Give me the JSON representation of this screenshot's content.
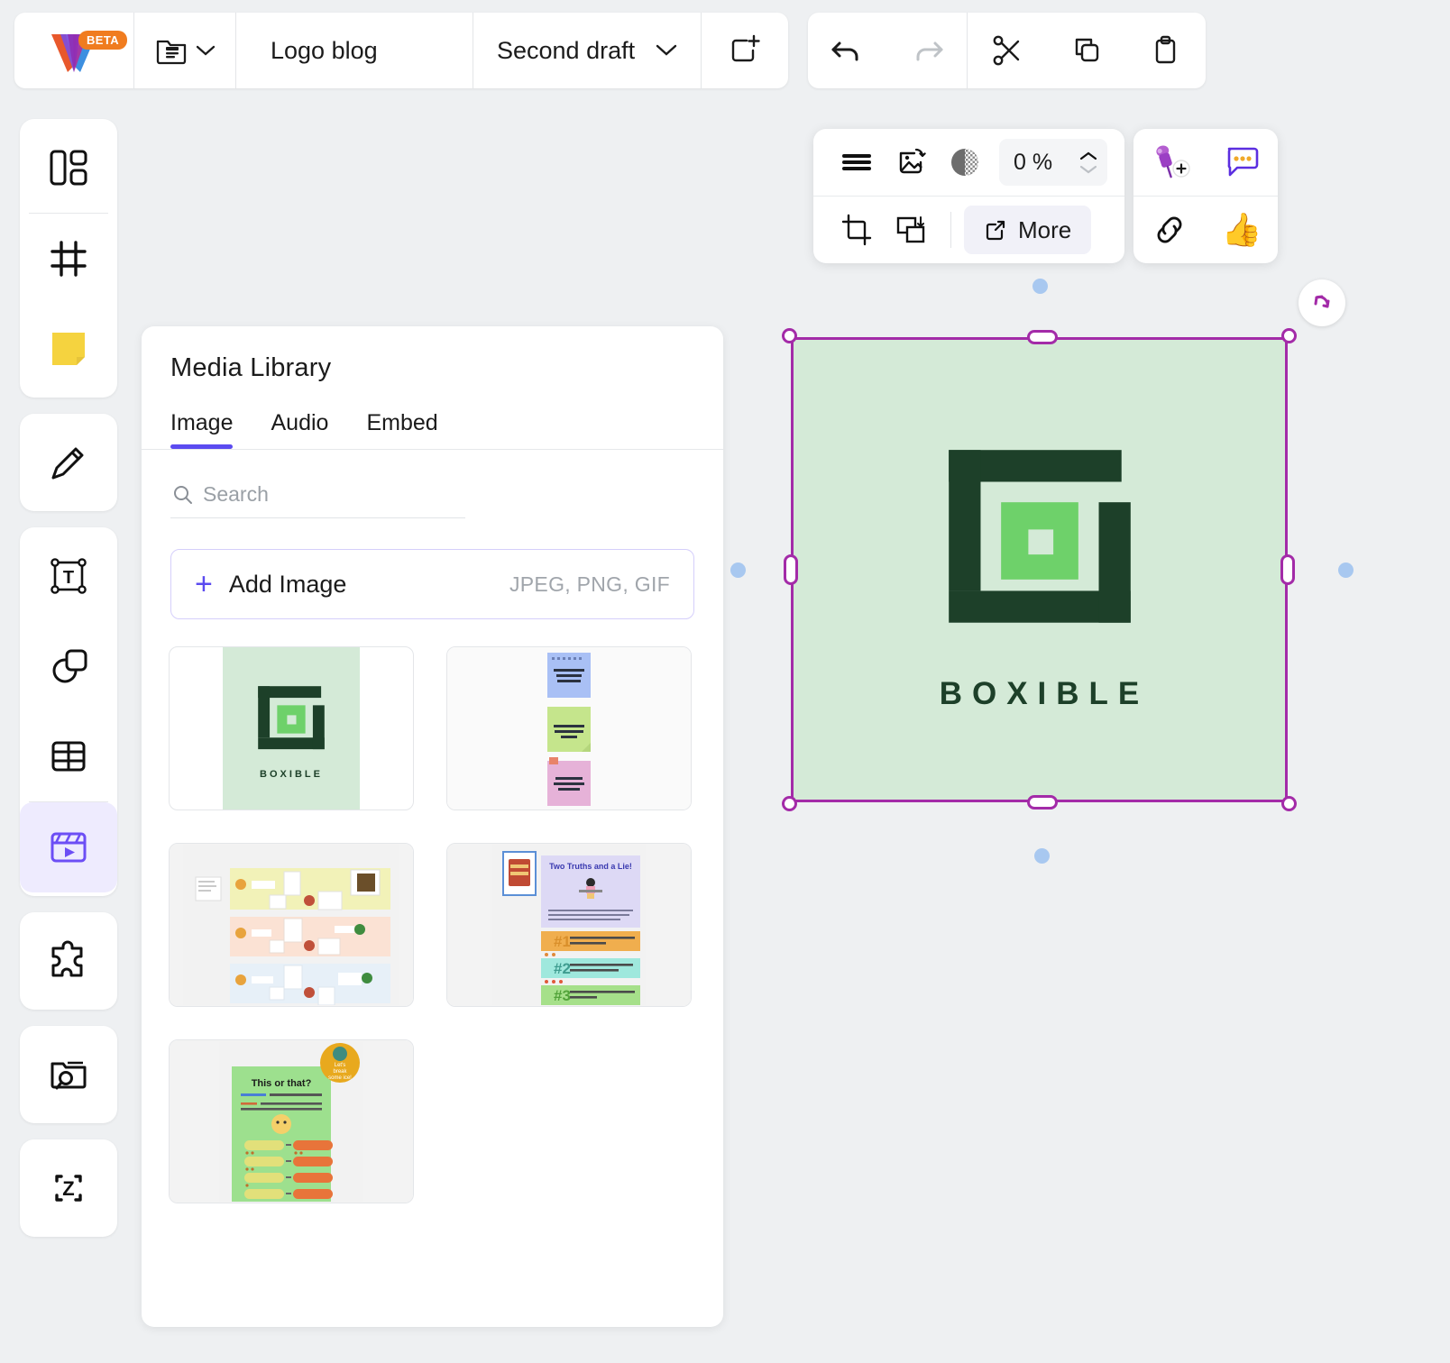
{
  "topbar": {
    "beta_badge": "BETA",
    "logo_icon": "vaia-logo",
    "folder_icon": "folder-document-icon",
    "folder_chevron_icon": "chevron-down-icon",
    "board_title": "Logo blog",
    "draft_name": "Second draft",
    "draft_chevron_icon": "chevron-down-icon",
    "add_frame_icon": "add-frame-icon",
    "actions": [
      {
        "name": "undo-button",
        "icon": "undo-arrow-icon",
        "disabled": false
      },
      {
        "name": "redo-button",
        "icon": "redo-arrow-icon",
        "disabled": true
      },
      {
        "name": "cut-button",
        "icon": "scissors-icon",
        "disabled": false
      },
      {
        "name": "copy-button",
        "icon": "copy-icon",
        "disabled": false
      },
      {
        "name": "paste-button",
        "icon": "clipboard-icon",
        "disabled": false
      }
    ]
  },
  "left_toolbar": {
    "groups": [
      {
        "tools": [
          {
            "name": "tool-templates",
            "icon": "layout-panels-icon",
            "active": false
          },
          {
            "name": "tool-frame",
            "icon": "frame-grid-icon",
            "active": false
          },
          {
            "name": "tool-sticky-note",
            "icon": "sticky-note-icon",
            "active": false
          }
        ]
      },
      {
        "tools": [
          {
            "name": "tool-pen",
            "icon": "pencil-icon",
            "active": false
          }
        ]
      },
      {
        "tools": [
          {
            "name": "tool-text",
            "icon": "text-box-icon",
            "active": false
          },
          {
            "name": "tool-shapes",
            "icon": "shapes-icon",
            "active": false
          },
          {
            "name": "tool-table",
            "icon": "table-icon",
            "active": false
          },
          {
            "name": "tool-media",
            "icon": "media-player-icon",
            "active": true
          }
        ]
      },
      {
        "tools": [
          {
            "name": "tool-plugins",
            "icon": "puzzle-piece-icon",
            "active": false
          }
        ]
      },
      {
        "tools": [
          {
            "name": "tool-browse-files",
            "icon": "folder-search-icon",
            "active": false
          }
        ]
      },
      {
        "tools": [
          {
            "name": "tool-zoom-fit",
            "icon": "zoom-frame-z-icon",
            "active": false
          }
        ]
      }
    ]
  },
  "media_panel": {
    "title": "Media Library",
    "tabs": [
      {
        "label": "Image",
        "active": true
      },
      {
        "label": "Audio",
        "active": false
      },
      {
        "label": "Embed",
        "active": false
      }
    ],
    "search": {
      "placeholder": "Search",
      "value": "",
      "icon": "search-icon"
    },
    "add_image": {
      "label": "Add Image",
      "hint": "JPEG, PNG, GIF",
      "plus_icon": "plus-icon"
    },
    "thumbnails": [
      {
        "name": "thumb-boxible-logo",
        "kind": "logo",
        "word": "BOXIBLE"
      },
      {
        "name": "thumb-sticky-notes",
        "kind": "stickies"
      },
      {
        "name": "thumb-journey-map",
        "kind": "journey"
      },
      {
        "name": "thumb-two-truths",
        "kind": "twotruths",
        "heading": "Two Truths and a Lie!",
        "items": [
          "#1",
          "#2",
          "#3"
        ]
      },
      {
        "name": "thumb-this-or-that",
        "kind": "thisorthat",
        "heading": "This or that?"
      }
    ]
  },
  "context_toolbar": {
    "row1": [
      {
        "name": "align-menu-button",
        "icon": "hamburger-lines-icon"
      },
      {
        "name": "replace-image-button",
        "icon": "replace-image-icon"
      },
      {
        "name": "opacity-button",
        "icon": "opacity-contrast-icon"
      }
    ],
    "opacity": {
      "value": "0 %",
      "up_icon": "chevron-up-icon",
      "down_icon": "chevron-down-icon"
    },
    "row2": [
      {
        "name": "crop-button",
        "icon": "crop-icon"
      },
      {
        "name": "arrange-layer-button",
        "icon": "send-to-back-icon"
      }
    ],
    "more": {
      "label": "More",
      "icon": "external-link-icon"
    }
  },
  "reaction_toolbar": {
    "items": [
      {
        "name": "add-pin-button",
        "icon": "pushpin-plus-icon",
        "glyph": "📌"
      },
      {
        "name": "comment-button",
        "icon": "comment-bubble-icon"
      },
      {
        "name": "link-button",
        "icon": "link-chain-icon"
      },
      {
        "name": "thumbs-up-button",
        "icon": "thumbs-up-icon",
        "glyph": "👍"
      }
    ]
  },
  "canvas": {
    "selected_object": {
      "name": "boxible-logo-image",
      "word": "BOXIBLE",
      "bg_color": "#d4ead7",
      "dark_color": "#1d4029",
      "accent_color": "#6ed16a",
      "center_color": "#d4ead7"
    },
    "selection": {
      "border_color": "#a32ba8",
      "rotate_icon": "rotate-handle-icon",
      "handles": [
        "top-left",
        "top-center",
        "top-right",
        "middle-left",
        "middle-right",
        "bottom-left",
        "bottom-center",
        "bottom-right"
      ]
    },
    "presence_dots": [
      {
        "name": "presence-dot-top",
        "color": "#a8c8f0"
      },
      {
        "name": "presence-dot-left",
        "color": "#a8c8f0"
      },
      {
        "name": "presence-dot-right",
        "color": "#a8c8f0"
      },
      {
        "name": "presence-dot-bottom",
        "color": "#a8c8f0"
      }
    ]
  }
}
